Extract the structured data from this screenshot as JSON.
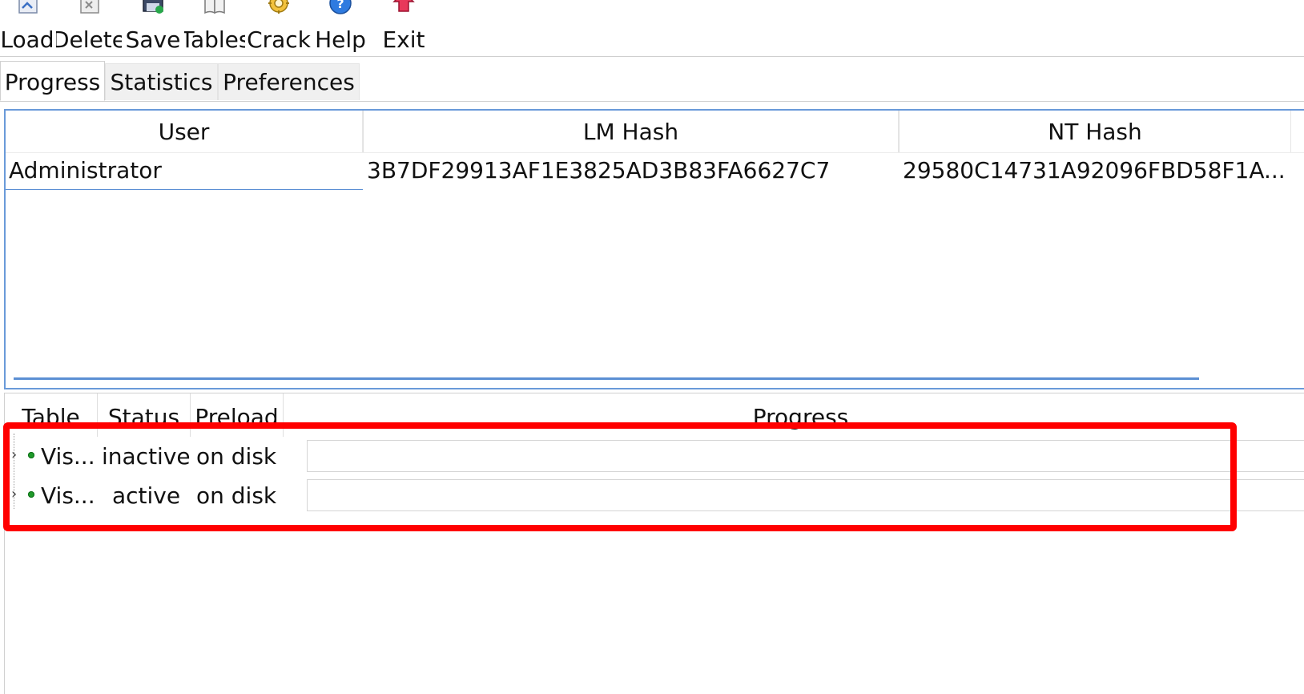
{
  "toolbar": {
    "buttons": [
      {
        "label": "Load",
        "icon": "load-icon"
      },
      {
        "label": "Delete",
        "icon": "delete-icon"
      },
      {
        "label": "Save",
        "icon": "save-icon"
      },
      {
        "label": "Tables",
        "icon": "tables-icon"
      },
      {
        "label": "Crack",
        "icon": "crack-icon"
      },
      {
        "label": "Help",
        "icon": "help-icon"
      },
      {
        "label": "Exit",
        "icon": "exit-icon"
      }
    ]
  },
  "tabs": [
    {
      "label": "Progress",
      "active": true
    },
    {
      "label": "Statistics",
      "active": false
    },
    {
      "label": "Preferences",
      "active": false
    }
  ],
  "users_grid": {
    "columns": [
      "User",
      "LM Hash",
      "NT Hash"
    ],
    "rows": [
      {
        "user": "Administrator",
        "lm_hash": "3B7DF29913AF1E3825AD3B83FA6627C7",
        "nt_hash": "29580C14731A92096FBD58F1A..."
      }
    ]
  },
  "tables_grid": {
    "columns": [
      "Table",
      "Status",
      "Preload",
      "Progress"
    ],
    "rows": [
      {
        "table": "Vis...",
        "status": "inactive",
        "preload": "on disk",
        "progress": 0,
        "status_color": "#1f9a2a"
      },
      {
        "table": "Vis...",
        "status": "active",
        "preload": "on disk",
        "progress": 0,
        "status_color": "#1f9a2a"
      }
    ]
  },
  "colors": {
    "highlight": "#ff0000",
    "panel_border": "#6a9ad9",
    "status_dot": "#1f9a2a"
  }
}
